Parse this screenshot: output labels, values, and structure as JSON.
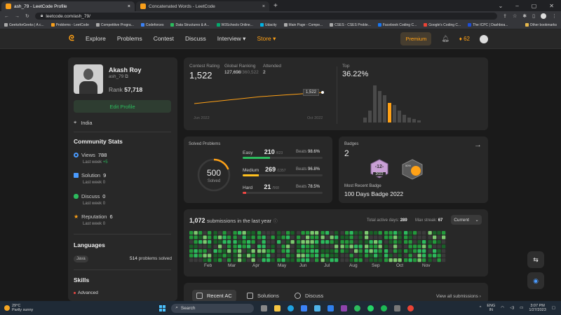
{
  "browser": {
    "tabs": [
      {
        "title": "ash_79 - LeetCode Profile",
        "active": true
      },
      {
        "title": "Concatenated Words - LeetCode",
        "active": false
      }
    ],
    "new_tab": "+",
    "url": "leetcode.com/ash_79/",
    "bookmarks": [
      "GeeksforGeeks | A c...",
      "Problems - LeetCode",
      "Competitive Progra...",
      "Codeforces",
      "Data Structures & A...",
      "W3Schools Online...",
      "Udacity",
      "Main Page - Compe...",
      "CSES - CSES Proble...",
      "Facebook Coding C...",
      "Google's Coding C...",
      "The ICPC | Dashboa..."
    ],
    "other_bookmarks": "Other bookmarks"
  },
  "nav": {
    "links": [
      "Explore",
      "Problems",
      "Contest",
      "Discuss",
      "Interview ▾",
      "Store ▾"
    ],
    "premium": "Premium",
    "streak": "62"
  },
  "profile": {
    "name": "Akash Roy",
    "handle": "ash_79",
    "rank_label": "Rank",
    "rank": "57,718",
    "edit": "Edit Profile",
    "location": "India"
  },
  "community": {
    "title": "Community Stats",
    "items": [
      {
        "label": "Views",
        "value": "788",
        "last_week": "Last week",
        "delta": "+5",
        "color": "#4a9bff"
      },
      {
        "label": "Solution",
        "value": "9",
        "last_week": "Last week",
        "delta": "0",
        "color": "#4a9bff"
      },
      {
        "label": "Discuss",
        "value": "0",
        "last_week": "Last week",
        "delta": "0",
        "color": "#2cbb5d"
      },
      {
        "label": "Reputation",
        "value": "6",
        "last_week": "Last week",
        "delta": "0",
        "color": "#ffa116"
      }
    ]
  },
  "languages": {
    "title": "Languages",
    "name": "Java",
    "count": "514",
    "suffix": "problems solved"
  },
  "skills": {
    "title": "Skills",
    "first": "Advanced"
  },
  "contest": {
    "rating_label": "Contest Rating",
    "rating": "1,522",
    "global_label": "Global Ranking",
    "global": "127,698",
    "global_total": "/360,522",
    "attended_label": "Attended",
    "attended": "2",
    "tooltip": "1,522",
    "x_start": "Jun 2022",
    "x_end": "Oct 2022",
    "top_label": "Top",
    "top": "36.22%"
  },
  "solved": {
    "title": "Solved Problems",
    "total": "500",
    "total_label": "Solved",
    "progress": 0.19,
    "rows": [
      {
        "label": "Easy",
        "count": "210",
        "total": "/623",
        "beats_label": "Beats",
        "beats": "98.6%",
        "fraction": 0.34,
        "color": "#2cbb5d"
      },
      {
        "label": "Medium",
        "count": "269",
        "total": "/1357",
        "beats_label": "Beats",
        "beats": "96.8%",
        "fraction": 0.2,
        "color": "#ffc01e"
      },
      {
        "label": "Hard",
        "count": "21",
        "total": "/568",
        "beats_label": "Beats",
        "beats": "78.5%",
        "fraction": 0.04,
        "color": "#ef4743"
      }
    ]
  },
  "badges": {
    "title": "Badges",
    "count": "2",
    "badge_year": "2022",
    "badge_num": "-12-",
    "badge2": "50%",
    "recent_label": "Most Recent Badge",
    "recent": "100 Days Badge 2022"
  },
  "submissions": {
    "count": "1,072",
    "label": "submissions in the last year",
    "active_label": "Total active days:",
    "active": "289",
    "streak_label": "Max streak:",
    "streak": "67",
    "current": "Current",
    "months": [
      "Feb",
      "Mar",
      "Apr",
      "May",
      "Jun",
      "Jul",
      "Aug",
      "Sep",
      "Oct",
      "Nov"
    ]
  },
  "recent_tabs": {
    "items": [
      "Recent AC",
      "Solutions",
      "Discuss"
    ],
    "view_all": "View all submissions"
  },
  "taskbar": {
    "temp": "29°C",
    "weather": "Partly sunny",
    "search": "Search",
    "lang": "ENG",
    "region": "IN",
    "time": "3:07 PM",
    "date": "1/27/2023"
  }
}
